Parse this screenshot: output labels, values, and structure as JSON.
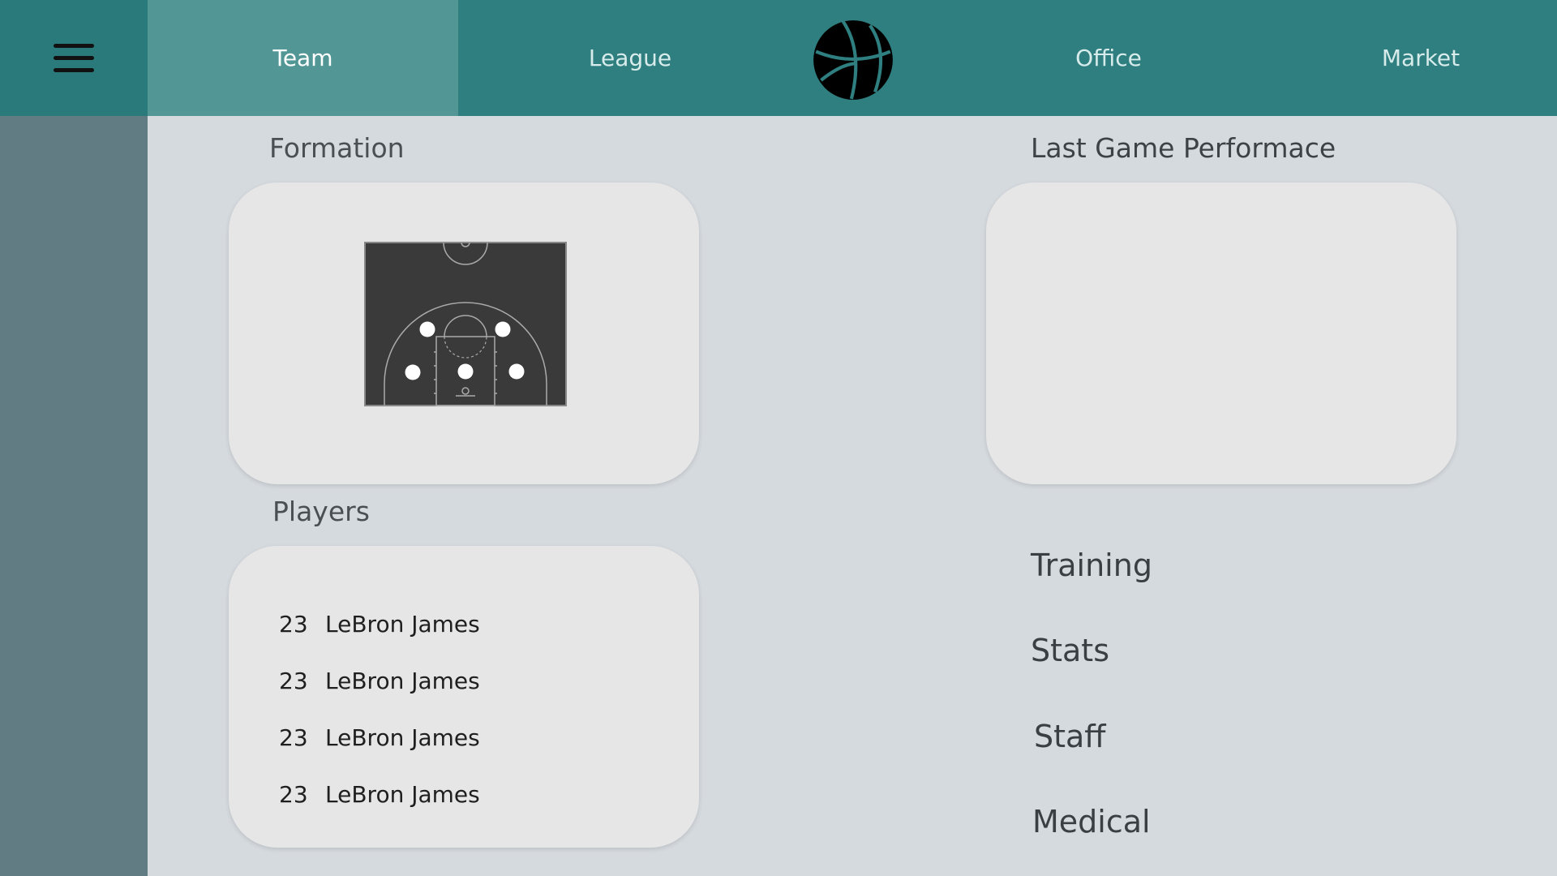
{
  "nav": {
    "menu_icon": "hamburger-icon",
    "tabs": [
      {
        "label": "Team",
        "active": true
      },
      {
        "label": "League",
        "active": false
      },
      {
        "label": "Office",
        "active": false
      },
      {
        "label": "Market",
        "active": false
      }
    ],
    "logo_icon": "basketball-icon"
  },
  "colors": {
    "topbar": "#2f7f80",
    "active_tab": "#529795",
    "sidebar": "#627c84",
    "background": "#d5dadf",
    "card": "#e6e6e6",
    "court": "#3a3a3a"
  },
  "formation": {
    "title": "Formation",
    "court_icon": "basketball-half-court",
    "player_count": 5
  },
  "performance": {
    "title": "Last Game Performace"
  },
  "players": {
    "title": "Players",
    "list": [
      {
        "number": "23",
        "name": "LeBron James"
      },
      {
        "number": "23",
        "name": "LeBron James"
      },
      {
        "number": "23",
        "name": "LeBron James"
      },
      {
        "number": "23",
        "name": "LeBron James"
      }
    ]
  },
  "links": {
    "training": "Training",
    "stats": "Stats",
    "staff": "Staff",
    "medical": "Medical"
  }
}
